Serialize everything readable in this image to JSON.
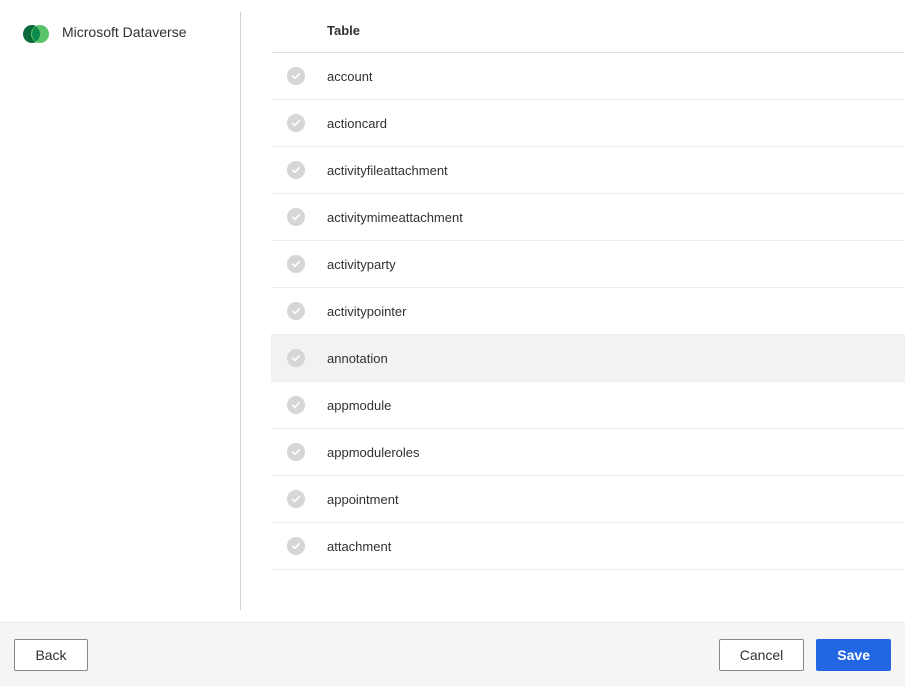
{
  "connector": {
    "name": "Microsoft Dataverse"
  },
  "tableList": {
    "header": "Table",
    "rows": [
      {
        "name": "account",
        "highlighted": false
      },
      {
        "name": "actioncard",
        "highlighted": false
      },
      {
        "name": "activityfileattachment",
        "highlighted": false
      },
      {
        "name": "activitymimeattachment",
        "highlighted": false
      },
      {
        "name": "activityparty",
        "highlighted": false
      },
      {
        "name": "activitypointer",
        "highlighted": false
      },
      {
        "name": "annotation",
        "highlighted": true
      },
      {
        "name": "appmodule",
        "highlighted": false
      },
      {
        "name": "appmoduleroles",
        "highlighted": false
      },
      {
        "name": "appointment",
        "highlighted": false
      },
      {
        "name": "attachment",
        "highlighted": false
      }
    ]
  },
  "footer": {
    "back_label": "Back",
    "cancel_label": "Cancel",
    "save_label": "Save"
  }
}
